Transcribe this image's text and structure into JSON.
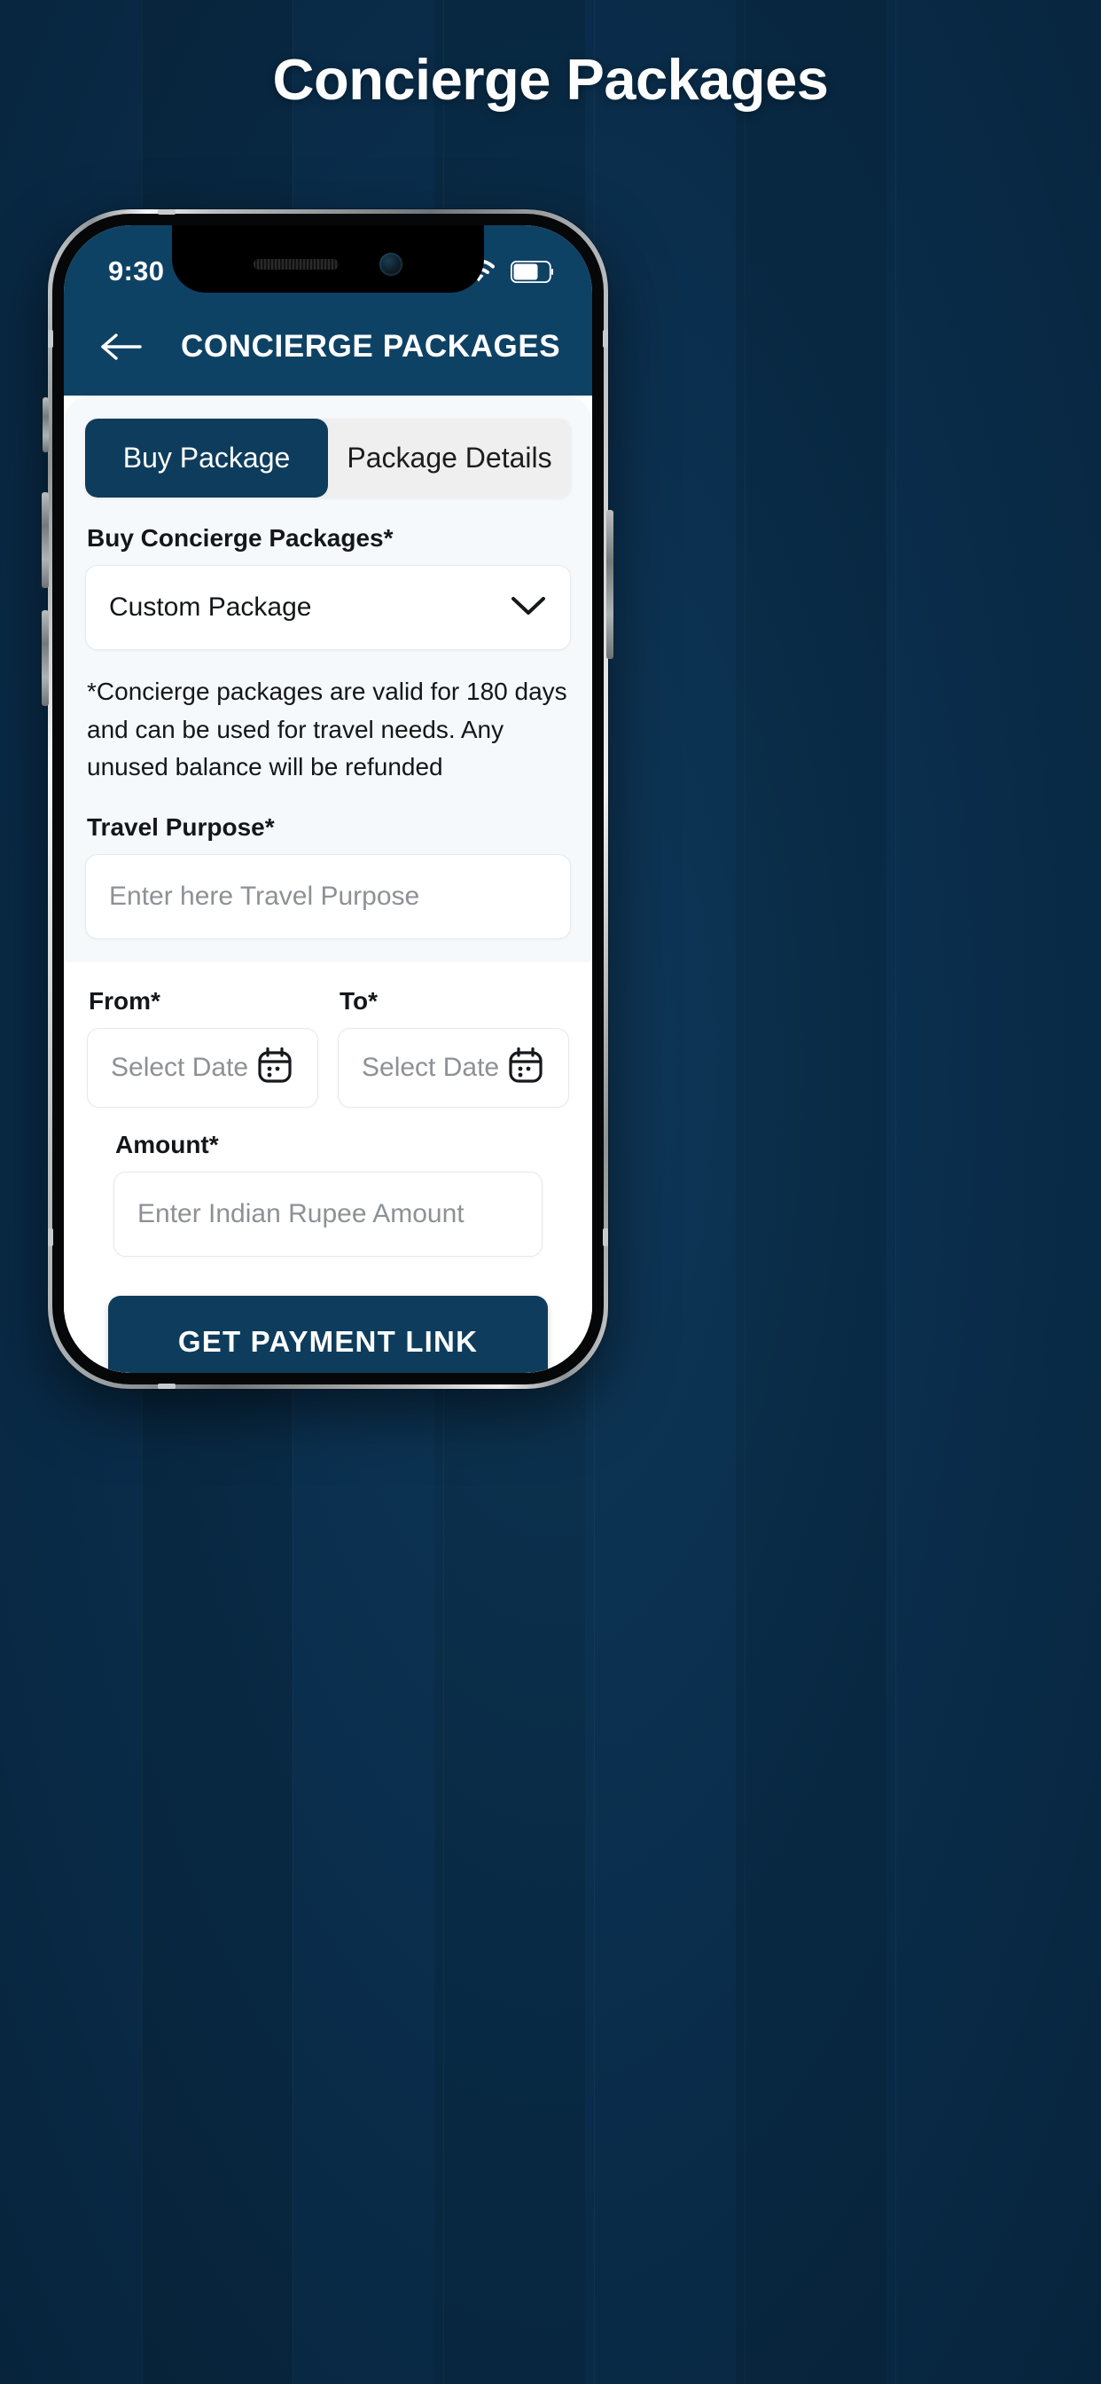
{
  "page": {
    "title": "Concierge Packages"
  },
  "device": {
    "status_bar": {
      "time": "9:30",
      "icons": [
        "signal-icon",
        "wifi-icon",
        "battery-icon"
      ]
    }
  },
  "app": {
    "header": {
      "back_icon": "arrow-left-icon",
      "title": "CONCIERGE PACKAGES"
    },
    "tabs": [
      {
        "label": "Buy Package",
        "active": true
      },
      {
        "label": "Package Details",
        "active": false
      }
    ],
    "form": {
      "package_select": {
        "label": "Buy Concierge Packages*",
        "value": "Custom Package",
        "chevron_icon": "chevron-down-icon"
      },
      "disclaimer": "*Concierge packages are valid for 180 days and can be used for travel needs. Any unused balance will be refunded",
      "travel_purpose": {
        "label": "Travel Purpose*",
        "placeholder": "Enter here Travel Purpose",
        "value": ""
      },
      "from_date": {
        "label": "From*",
        "placeholder": "Select Date",
        "value": "",
        "icon": "calendar-icon"
      },
      "to_date": {
        "label": "To*",
        "placeholder": "Select Date",
        "value": "",
        "icon": "calendar-icon"
      },
      "amount": {
        "label": "Amount*",
        "placeholder": "Enter Indian Rupee Amount",
        "value": ""
      },
      "submit_label": "GET PAYMENT LINK"
    }
  },
  "colors": {
    "page_background": "#0a2d49",
    "brand_navy": "#0e3c5c",
    "header_navy": "#0e4265",
    "sheet_tint": "#f6f9fc",
    "tab_inactive": "#efefef",
    "placeholder_gray": "#8d9196"
  }
}
